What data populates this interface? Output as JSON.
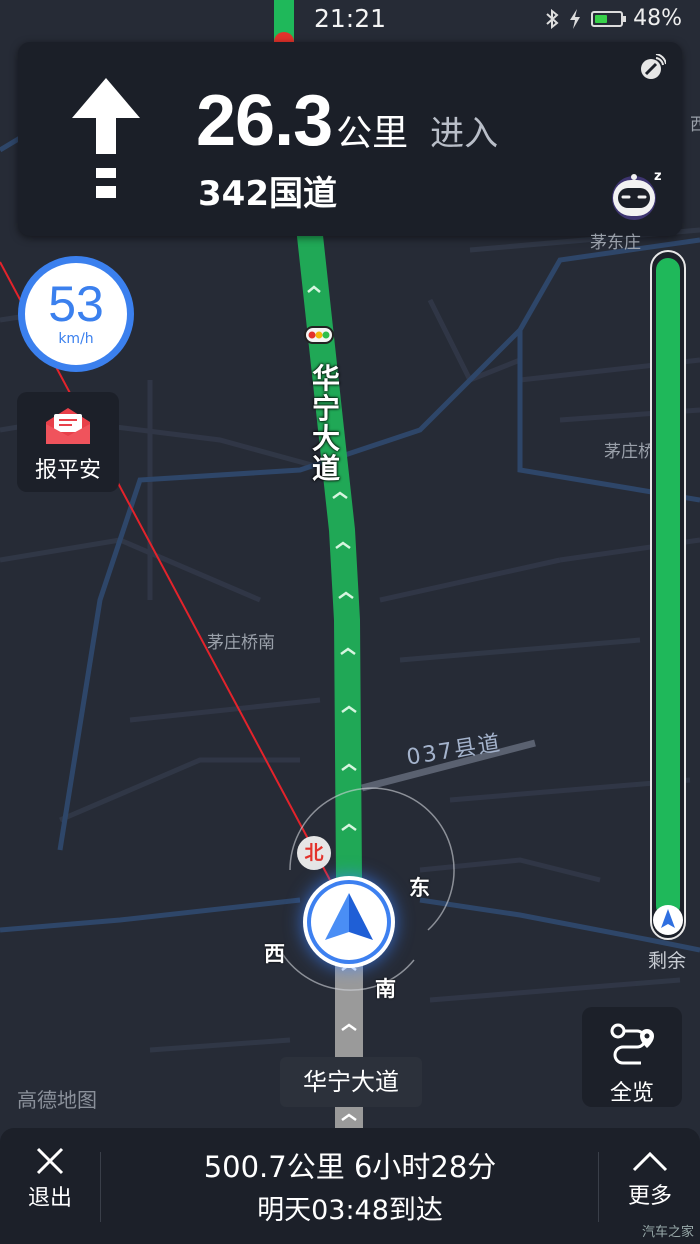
{
  "status_bar": {
    "time": "21:21",
    "battery_percent_label": "48%",
    "battery_level": 0.48,
    "icons": [
      "bluetooth-icon",
      "charging-icon",
      "battery-icon"
    ]
  },
  "guidance": {
    "maneuver_icon": "straight-arrow-icon",
    "distance_value": "26.3",
    "distance_unit": "公里",
    "action": "进入",
    "next_road": "342国道"
  },
  "speed": {
    "value": "53",
    "unit": "km/h"
  },
  "safety_button": {
    "label": "报平安",
    "icon": "envelope-icon"
  },
  "map": {
    "current_road_vertical": "华宁大道",
    "county_road": "037县道",
    "place_labels": {
      "maozhuangqiaonan": "茅庄桥南",
      "maozhuangqiao_right": "茅庄桥",
      "top_right_partial": "西宁",
      "under_card_partial": "茅东庄"
    }
  },
  "compass": {
    "north": "北",
    "east": "东",
    "south": "南",
    "west": "西"
  },
  "route_progress": {
    "label": "剩余",
    "remaining_fraction": 1.0
  },
  "overview_button": {
    "label": "全览",
    "icon": "route-overview-icon"
  },
  "current_road_chip": "华宁大道",
  "brand": "高德地图",
  "bottom_bar": {
    "exit_label": "退出",
    "summary": "500.7公里 6小时28分",
    "eta": "明天03:48到达",
    "more_label": "更多"
  },
  "watermark": "汽车之家",
  "colors": {
    "route_green": "#1fb85a",
    "accent_blue": "#3b80ee",
    "background": "#262b36",
    "restriction_red": "#e3322b"
  }
}
